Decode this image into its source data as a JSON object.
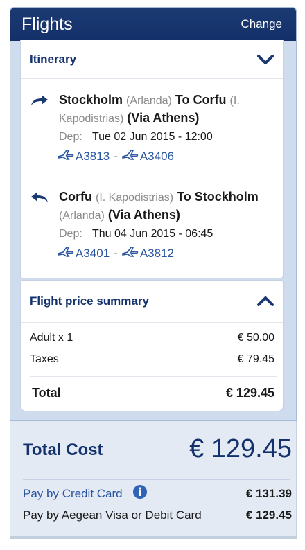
{
  "header": {
    "title": "Flights",
    "change_label": "Change"
  },
  "itinerary": {
    "label": "Itinerary",
    "flights": [
      {
        "origin": "Stockholm",
        "origin_airport": "(Arlanda)",
        "to_word": "To",
        "destination": "Corfu",
        "destination_airport": "(I. Kapodistrias)",
        "via": "(Via Athens)",
        "dep_label": "Dep:",
        "dep_value": "Tue 02 Jun 2015 - 12:00",
        "codes": [
          "A3813",
          "A3406"
        ]
      },
      {
        "origin": "Corfu",
        "origin_airport": "(I. Kapodistrias)",
        "to_word": "To",
        "destination": "Stockholm",
        "destination_airport": "(Arlanda)",
        "via": "(Via Athens)",
        "dep_label": "Dep:",
        "dep_value": "Thu 04 Jun 2015 - 06:45",
        "codes": [
          "A3401",
          "A3812"
        ]
      }
    ]
  },
  "price_summary": {
    "label": "Flight price summary",
    "rows": [
      {
        "label": "Adult x 1",
        "value": "€ 50.00"
      },
      {
        "label": "Taxes",
        "value": "€ 79.45"
      }
    ],
    "total_label": "Total",
    "total_value": "€ 129.45"
  },
  "footer": {
    "total_cost_label": "Total Cost",
    "total_cost_value": "€ 129.45",
    "pay_credit_label": "Pay by Credit Card",
    "pay_credit_value": "€ 131.39",
    "pay_debit_label": "Pay by Aegean Visa or Debit Card",
    "pay_debit_value": "€ 129.45"
  },
  "colors": {
    "navy": "#14306a",
    "link": "#2a55a0",
    "panel": "#cfdcee"
  },
  "icons": [
    "chevron-down-icon",
    "chevron-up-icon",
    "arrow-right-icon",
    "arrow-return-icon",
    "airplane-icon",
    "info-icon"
  ]
}
